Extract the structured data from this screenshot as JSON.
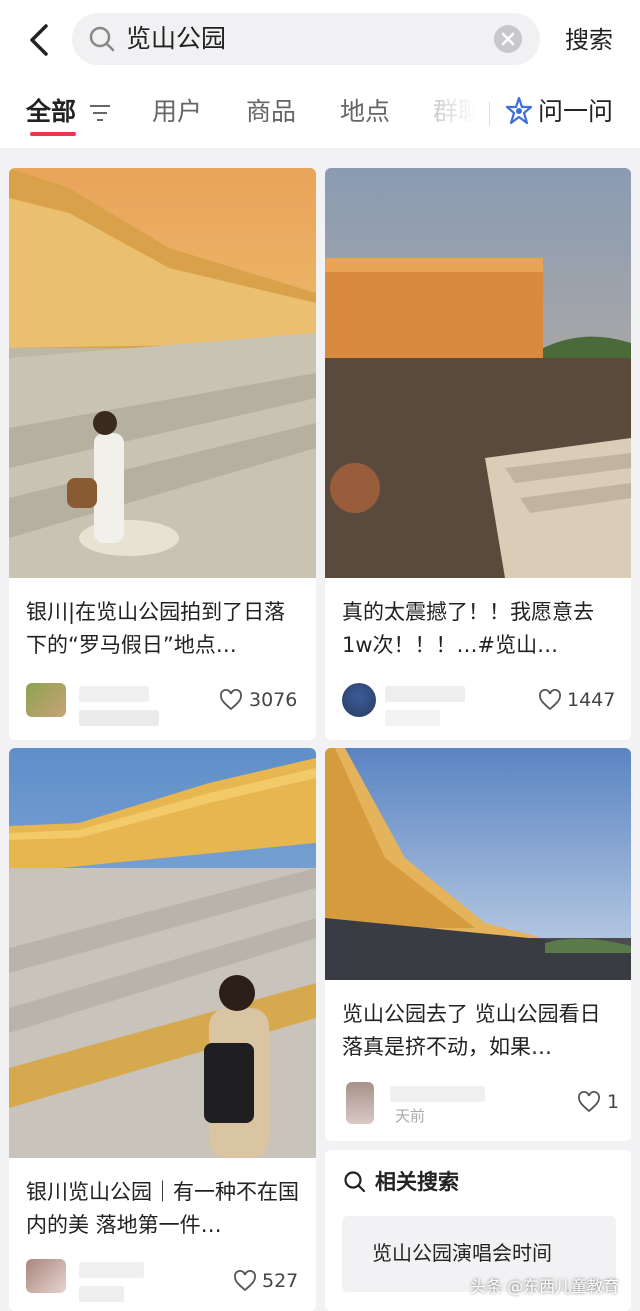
{
  "search": {
    "query": "览山公园",
    "button_label": "搜索"
  },
  "tabs": [
    {
      "label": "全部"
    },
    {
      "label": "用户"
    },
    {
      "label": "商品"
    },
    {
      "label": "地点"
    },
    {
      "label": "群聊"
    }
  ],
  "ask": {
    "label": "问一问"
  },
  "posts": [
    {
      "title": "银川|在览山公园拍到了日落下的“罗马假日”地点…",
      "likes": "3076"
    },
    {
      "title": "真的太震撼了！！我愿意去1w次！！！…#览山…",
      "likes": "1447"
    },
    {
      "title": "银川览山公园｜有一种不在国内的美 落地第一件…",
      "likes": "527"
    },
    {
      "title": "览山公园去了 览山公园看日落真是挤不动，如果…",
      "likes": "1",
      "meta_suffix": "天前"
    }
  ],
  "related": {
    "title": "相关搜索",
    "items": [
      "览山公园演唱会时间"
    ]
  },
  "watermark": "头条 @东西儿童教育",
  "colors": {
    "accent": "#e8384d",
    "ask_icon": "#3f6fd8"
  }
}
